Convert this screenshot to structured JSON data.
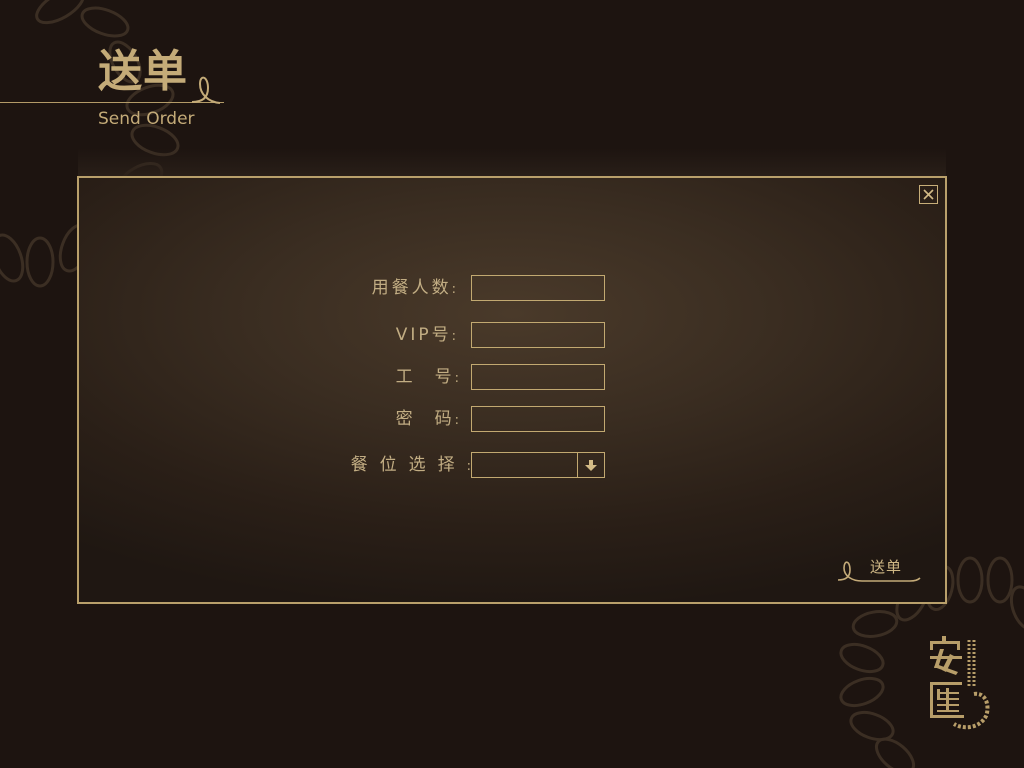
{
  "header": {
    "title": "送单",
    "subtitle": "Send Order"
  },
  "dialog": {
    "close_icon": "close-icon",
    "fields": {
      "diners": {
        "label_a": "用餐人数",
        "label_b": "",
        "value": ""
      },
      "vip": {
        "label_a": "VIP号",
        "label_b": "",
        "value": ""
      },
      "employee_id": {
        "label_a": "工",
        "label_b": "号",
        "value": ""
      },
      "password": {
        "label_a": "密",
        "label_b": "码",
        "value": ""
      },
      "seat": {
        "label_a": "餐位选择",
        "label_b": "",
        "value": "",
        "dropdown_icon": "arrow-down-icon"
      }
    },
    "label_suffix": ":",
    "submit_label": "送单"
  },
  "brand": {
    "logo_icon": "anhui-logo-icon"
  },
  "colors": {
    "background": "#1d1410",
    "gold": "#c4ab78",
    "panel_center": "#4a3a2a"
  }
}
